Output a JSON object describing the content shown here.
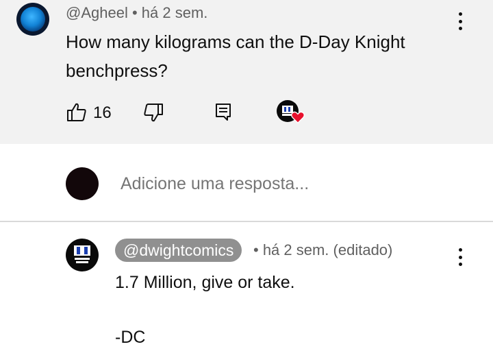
{
  "comment": {
    "author": "@Agheel",
    "time": "• há 2 sem.",
    "text": "How many kilograms can the D-Day Knight benchpress?",
    "like_count": "16",
    "avatar_icon": "globe-avatar",
    "colors": {
      "card_bg": "#f2f2f2",
      "heart": "#e8112d"
    }
  },
  "reply_composer": {
    "placeholder": "Adicione uma resposta..."
  },
  "reply": {
    "author": "@dwightcomics",
    "meta": "• há 2 sem. (editado)",
    "text": "1.7 Million, give or take.\n\n-DC",
    "logo_label": "DWIGHT COMICS",
    "colors": {
      "chip_bg": "#909090",
      "chip_text": "#ffffff"
    }
  }
}
